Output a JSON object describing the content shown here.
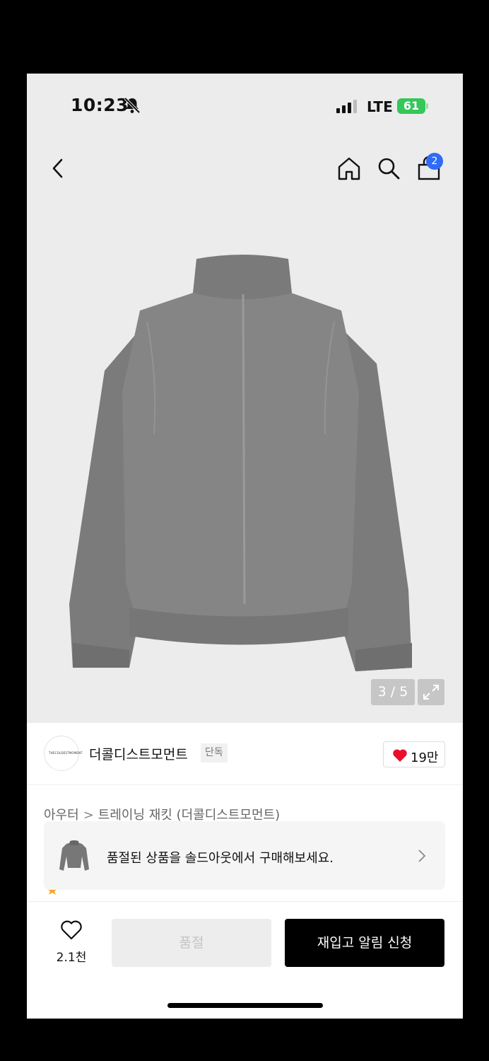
{
  "status": {
    "time": "10:23",
    "network": "LTE",
    "battery": "61"
  },
  "nav": {
    "back_icon": "chevron-left-icon",
    "home_icon": "home-icon",
    "search_icon": "search-icon",
    "bag_icon": "shopping-bag-icon",
    "bag_badge": "2"
  },
  "gallery": {
    "indicator": "3 / 5",
    "expand_icon": "expand-icon"
  },
  "brand": {
    "name": "더콜디스트모먼트",
    "tag": "단독",
    "logo_text": "THECOLDESTMOMENT",
    "likes": "19만"
  },
  "breadcrumb": {
    "category": "아우터",
    "separator": ">",
    "subcategory": "트레이닝 재킷 (더콜디스트모먼트)"
  },
  "banner": {
    "text": "품절된 상품을 솔드아웃에서 구매해보세요."
  },
  "bottom": {
    "wish_count": "2.1천",
    "soldout_label": "품절",
    "restock_label": "재입고 알림 신청"
  },
  "colors": {
    "accent_blue": "#2f6bf5",
    "heart_red": "#e8102b",
    "battery_green": "#34c759"
  }
}
